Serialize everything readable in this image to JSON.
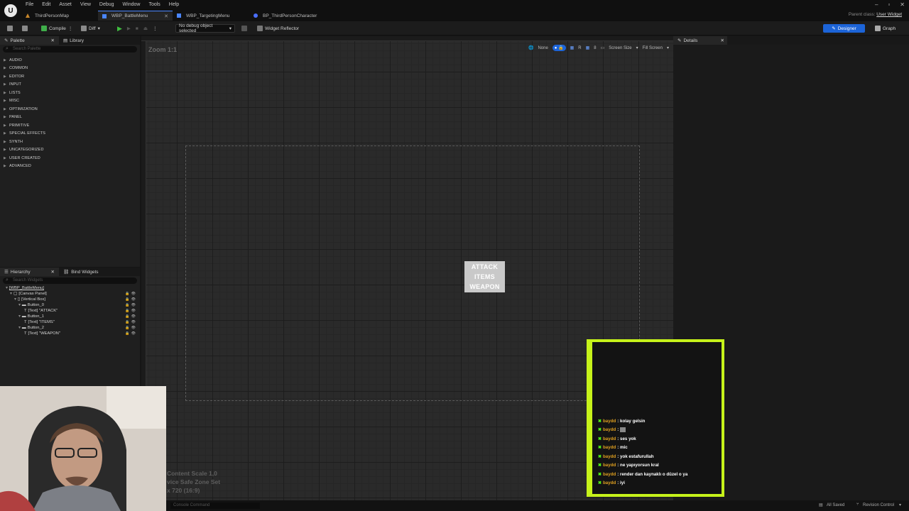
{
  "menus": [
    "File",
    "Edit",
    "Asset",
    "View",
    "Debug",
    "Window",
    "Tools",
    "Help"
  ],
  "tabs": [
    {
      "label": "ThirdPersonMap",
      "active": false
    },
    {
      "label": "WBP_BattleMenu",
      "active": true
    },
    {
      "label": "WBP_TargetingMenu",
      "active": false
    },
    {
      "label": "BP_ThirdPersonCharacter",
      "active": false
    }
  ],
  "parent_class": {
    "label": "Parent class:",
    "value": "User Widget"
  },
  "toolbar": {
    "compile": "Compile",
    "diff": "Diff",
    "debug_select": "No debug object selected",
    "widget_reflector": "Widget Reflector",
    "designer": "Designer",
    "graph": "Graph"
  },
  "palette": {
    "tab": "Palette",
    "library_tab": "Library",
    "search_placeholder": "Search Palette",
    "categories": [
      "AUDIO",
      "COMMON",
      "EDITOR",
      "INPUT",
      "LISTS",
      "MISC",
      "OPTIMIZATION",
      "PANEL",
      "PRIMITIVE",
      "SPECIAL EFFECTS",
      "SYNTH",
      "UNCATEGORIZED",
      "USER CREATED",
      "ADVANCED"
    ]
  },
  "hierarchy": {
    "tab": "Hierarchy",
    "bind_tab": "Bind Widgets",
    "search_placeholder": "Search Widgets",
    "rows": [
      {
        "label": "[WBP_BattleMenu]",
        "indent": 0
      },
      {
        "label": "[Canvas Panel]",
        "indent": 1
      },
      {
        "label": "[Vertical Box]",
        "indent": 2
      },
      {
        "label": "Button_0",
        "indent": 3
      },
      {
        "label": "[Text] \"ATTACK\"",
        "indent": 4
      },
      {
        "label": "Button_1",
        "indent": 3
      },
      {
        "label": "[Text] \"ITEMS\"",
        "indent": 4
      },
      {
        "label": "Button_2",
        "indent": 3
      },
      {
        "label": "[Text] \"WEAPON\"",
        "indent": 4
      }
    ]
  },
  "viewport": {
    "zoom": "Zoom 1:1",
    "tools": {
      "none": "None",
      "r": "R",
      "eight": "8",
      "screen_size": "Screen Size",
      "fill_screen": "Fill Screen"
    },
    "menu_buttons": [
      "ATTACK",
      "ITEMS",
      "WEAPON"
    ],
    "info": [
      "Content Scale 1,0",
      "vice Safe Zone Set",
      "x 720 (16:9)"
    ]
  },
  "details": {
    "tab": "Details"
  },
  "status": {
    "console": "Console Command",
    "saved": "All Saved",
    "revision": "Revision Control"
  },
  "chat": [
    {
      "user": "baydd",
      "msg": ": kolay gelsin"
    },
    {
      "user": "baydd",
      "msg": ": "
    },
    {
      "user": "baydd",
      "msg": ": ses yok"
    },
    {
      "user": "baydd",
      "msg": ": mic"
    },
    {
      "user": "baydd",
      "msg": ": yok estafurullah"
    },
    {
      "user": "baydd",
      "msg": ": ne yapıyorsun kral"
    },
    {
      "user": "baydd",
      "msg": ": render dan kaynaklı o düzel o ya"
    },
    {
      "user": "baydd",
      "msg": ": iyi"
    }
  ],
  "colors": {
    "accent": "#1c64d8",
    "chat_border": "#c6f21a",
    "username": "#e0a020",
    "badge": "#53fc18"
  }
}
